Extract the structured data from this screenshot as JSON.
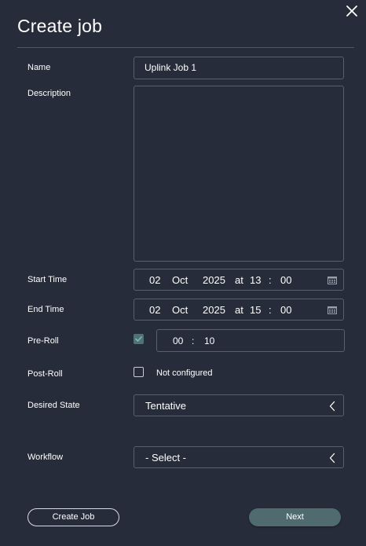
{
  "dialog": {
    "title": "Create job"
  },
  "form": {
    "name": {
      "label": "Name",
      "value": "Uplink Job 1"
    },
    "description": {
      "label": "Description",
      "value": ""
    },
    "start_time": {
      "label": "Start Time",
      "day": "02",
      "month": "Oct",
      "year": "2025",
      "at": "at",
      "hour": "13",
      "sep": ":",
      "minute": "00"
    },
    "end_time": {
      "label": "End Time",
      "day": "02",
      "month": "Oct",
      "year": "2025",
      "at": "at",
      "hour": "15",
      "sep": ":",
      "minute": "00"
    },
    "pre_roll": {
      "label": "Pre-Roll",
      "checked": true,
      "minutes": "00",
      "sep": ":",
      "seconds": "10"
    },
    "post_roll": {
      "label": "Post-Roll",
      "checked": false,
      "status": "Not configured"
    },
    "desired_state": {
      "label": "Desired State",
      "value": "Tentative"
    },
    "workflow": {
      "label": "Workflow",
      "value": "- Select -"
    }
  },
  "buttons": {
    "create_job": "Create Job",
    "next": "Next"
  },
  "colors": {
    "background": "#262c39",
    "border": "#586071",
    "checkbox_checked": "#4f7375",
    "next_button": "#4f6b6f"
  },
  "icons": {
    "close": "close-icon",
    "calendar": "calendar-icon",
    "chevron": "chevron-left-icon",
    "check": "check-icon"
  }
}
